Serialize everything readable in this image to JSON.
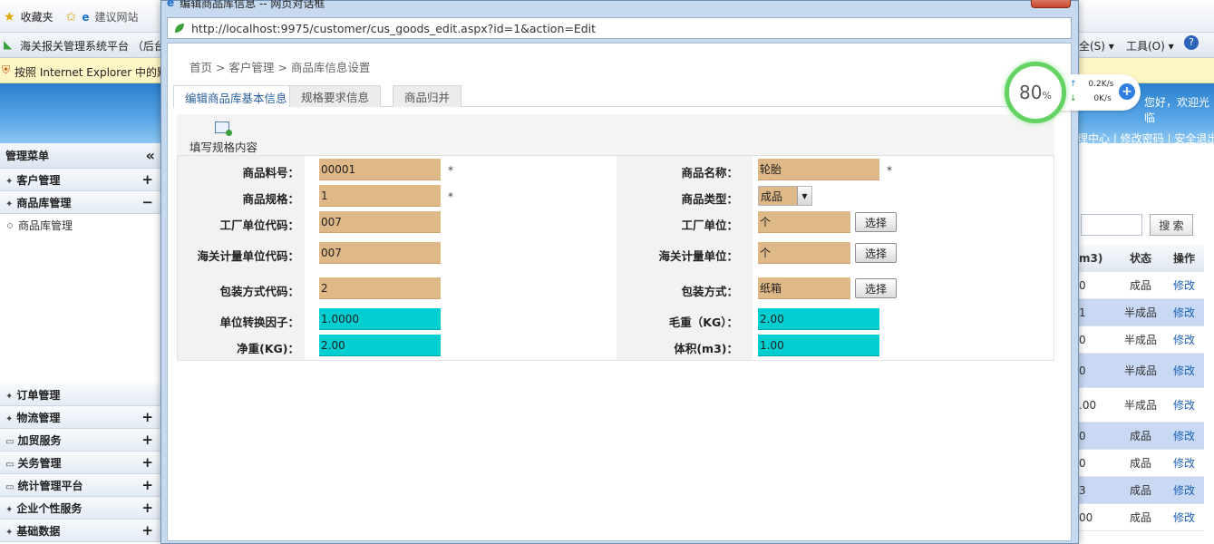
{
  "browser": {
    "favorites": "收藏夹",
    "suggested": "建议网站",
    "tab_title": "海关报关管理系统平台 （后台",
    "infobar": "按照 Internet Explorer 中的默",
    "safety_menu": "全(S)",
    "tools_menu": "工具(O)"
  },
  "page": {
    "greeting": "您好，欢迎光临",
    "links": "理中心 | 修改密码 | 安全退出",
    "search_button": "搜 索"
  },
  "sidebar": {
    "title": "管理菜单",
    "items": [
      {
        "label": "客户管理",
        "toggle": "+"
      },
      {
        "label": "商品库管理",
        "toggle": "−"
      }
    ],
    "sub": "商品库管理",
    "bottom_items": [
      {
        "label": "订单管理",
        "toggle": ""
      },
      {
        "label": "物流管理",
        "toggle": "+"
      },
      {
        "label": "加贸服务",
        "toggle": "+"
      },
      {
        "label": "关务管理",
        "toggle": "+"
      },
      {
        "label": "统计管理平台",
        "toggle": "+"
      },
      {
        "label": "企业个性服务",
        "toggle": "+"
      },
      {
        "label": "基础数据",
        "toggle": "+"
      }
    ]
  },
  "bg_table": {
    "headers": [
      "m3)",
      "状态",
      "操作"
    ],
    "rows": [
      {
        "c1": "0",
        "c2": "成品",
        "c3": "修改"
      },
      {
        "c1": "1",
        "c2": "半成品",
        "c3": "修改"
      },
      {
        "c1": "0",
        "c2": "半成品",
        "c3": "修改"
      },
      {
        "c1": "0",
        "c2": "半成品",
        "c3": "修改"
      },
      {
        "c1": ".00",
        "c2": "半成品",
        "c3": "修改"
      },
      {
        "c1": "0",
        "c2": "成品",
        "c3": "修改"
      },
      {
        "c1": "0",
        "c2": "成品",
        "c3": "修改"
      },
      {
        "c1": "3",
        "c2": "成品",
        "c3": "修改"
      },
      {
        "c1": "00",
        "c2": "成品",
        "c3": "修改"
      }
    ]
  },
  "dialog": {
    "title": "编辑商品库信息 -- 网页对话框",
    "url": "http://localhost:9975/customer/cus_goods_edit.aspx?id=1&action=Edit",
    "breadcrumb": "首页 > 客户管理 > 商品库信息设置",
    "tabs": [
      "编辑商品库基本信息",
      "规格要求信息",
      "商品归并"
    ],
    "toolbar_label": "填写规格内容",
    "choose_label": "选择",
    "fields": {
      "item_no_label": "商品料号：",
      "item_no": "00001",
      "name_label": "商品名称：",
      "name": "轮胎",
      "spec_label": "商品规格：",
      "spec": "1",
      "type_label": "商品类型：",
      "type": "成品",
      "factory_unit_code_label": "工厂单位代码：",
      "factory_unit_code": "007",
      "factory_unit_label": "工厂单位：",
      "factory_unit": "个",
      "customs_unit_code_label": "海关计量单位代码：",
      "customs_unit_code": "007",
      "customs_unit_label": "海关计量单位：",
      "customs_unit": "个",
      "pack_code_label": "包装方式代码：",
      "pack_code": "2",
      "pack_label": "包装方式：",
      "pack": "纸箱",
      "factor_label": "单位转换因子：",
      "factor": "1.0000",
      "gross_label": "毛重（KG）：",
      "gross": "2.00",
      "net_label": "净重(KG)：",
      "net": "2.00",
      "volume_label": "体积(m3)：",
      "volume": "1.00",
      "required_mark": "*"
    }
  },
  "speed_widget": {
    "percent": "80",
    "percent_sign": "%",
    "up": "0.2K/s",
    "down": "0K/s"
  }
}
